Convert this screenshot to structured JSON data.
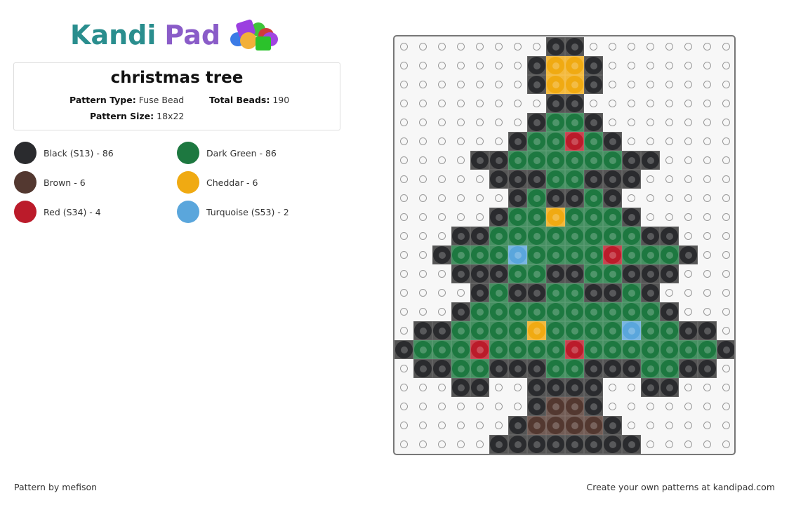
{
  "brand": {
    "word1": "Kandi",
    "word2": "Pad",
    "logo_icon": "bead-pile-icon"
  },
  "pattern": {
    "title": "christmas tree",
    "type_label": "Pattern Type:",
    "type_value": "Fuse Bead",
    "total_label": "Total Beads:",
    "total_value": "190",
    "size_label": "Pattern Size:",
    "size_value": "18x22"
  },
  "legend": [
    {
      "key": "K",
      "label": "Black (S13) - 86",
      "color": "#2a2b2e"
    },
    {
      "key": "G",
      "label": "Dark Green - 86",
      "color": "#1d7840"
    },
    {
      "key": "B",
      "label": "Brown - 6",
      "color": "#533830"
    },
    {
      "key": "Y",
      "label": "Cheddar - 6",
      "color": "#f0aa12"
    },
    {
      "key": "R",
      "label": "Red (S34) - 4",
      "color": "#bb1b2a"
    },
    {
      "key": "T",
      "label": "Turquoise (S53) - 2",
      "color": "#5aa6dc"
    }
  ],
  "grid": {
    "columns": 18,
    "rows": 22,
    "empty_symbol": ".",
    "cells": [
      "........KK........",
      ".......KYYK.......",
      ".......KYYK.......",
      "........KK........",
      ".......KGGK.......",
      "......KGGRGK......",
      "....KKGGGGGGKK....",
      ".....KKKGGKKK.....",
      "......KGKKGK......",
      ".....KGGYGGGK.....",
      "...KKGGGGGGGGKK...",
      "..KGGGTGGGGRGGGK..",
      "...KKKGGKKGGKKK...",
      "....KGKKGGKKGK....",
      "...KGGGGGGGGGGK...",
      ".KKGGGGYGGGGTGGKK.",
      "KGGGRGGGGRGGGGGGGK",
      ".KKGGKKKGGKKKGGKK.",
      "...KK..KKKK..KK...",
      ".......KBBK.......",
      "......KBBBBK......",
      ".....KKKKKKKK....."
    ]
  },
  "footer": {
    "credit": "Pattern by mefison",
    "promo": "Create your own patterns at kandipad.com"
  }
}
